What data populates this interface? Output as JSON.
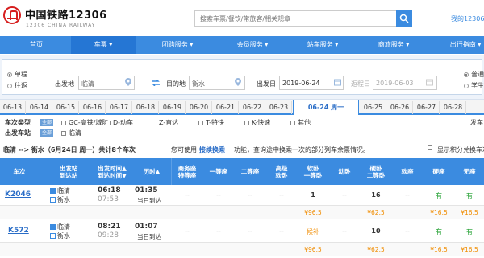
{
  "header": {
    "logo_title": "中国铁路12306",
    "logo_subtitle": "12306 CHINA RAILWAY",
    "search_placeholder": "搜索车票/餐饮/常旅客/相关规章",
    "my_account": "我的12306"
  },
  "nav": [
    {
      "label": "首页"
    },
    {
      "label": "车票 ▾"
    },
    {
      "label": "团购服务 ▾"
    },
    {
      "label": "会员服务 ▾"
    },
    {
      "label": "站车服务 ▾"
    },
    {
      "label": "商旅服务 ▾"
    },
    {
      "label": "出行指南 ▾"
    }
  ],
  "query": {
    "trip_single": "单程",
    "trip_round": "往返",
    "from_label": "出发地",
    "from_value": "临清",
    "to_label": "目的地",
    "to_value": "衡水",
    "depart_label": "出发日",
    "depart_value": "2019-06-24",
    "return_label": "返程日",
    "return_value": "2019-06-03",
    "type_normal": "普通",
    "type_student": "学生"
  },
  "dates": [
    "06-13",
    "06-14",
    "06-15",
    "06-16",
    "06-17",
    "06-18",
    "06-19",
    "06-20",
    "06-21",
    "06-22",
    "06-23",
    "06-24 周一",
    "06-25",
    "06-26",
    "06-27",
    "06-28"
  ],
  "filter": {
    "train_type_label": "车次类型",
    "depart_station_label": "出发车站",
    "all_btn": "全部",
    "types": [
      "GC-高铁/城际",
      "D-动车",
      "Z-直达",
      "T-特快",
      "K-快速",
      "其他"
    ],
    "station_linqing": "临清",
    "right_label": "发车"
  },
  "summary": {
    "route": "临清 --> 衡水（6月24日  周一）共计8个车次",
    "hint_prefix": "您可使用",
    "hint_link": "接续换乘",
    "hint_suffix": "功能，查询途中换乘一次的部分列车余票情况。",
    "points_label": "显示积分兑换车次"
  },
  "table": {
    "headers": [
      "车次",
      "出发站\n到达站",
      "出发时间▲\n到达时间▼",
      "历时▲",
      "商务座\n特等座",
      "一等座",
      "二等座",
      "高级\n软卧",
      "软卧\n一等卧",
      "动卧",
      "硬卧\n二等卧",
      "软座",
      "硬座",
      "无座"
    ],
    "rows": [
      {
        "train": "K2046",
        "from": "临清",
        "to": "衡水",
        "dep": "06:18",
        "arr": "07:53",
        "duration": "01:35",
        "duration_note": "当日到达",
        "cells": [
          "--",
          "--",
          "--",
          "--",
          "1",
          "--",
          "16",
          "--",
          "有",
          "有"
        ],
        "prices": [
          "",
          "",
          "",
          "",
          "¥96.5",
          "",
          "¥62.5",
          "",
          "¥16.5",
          "¥16.5"
        ]
      },
      {
        "train": "K572",
        "from": "临清",
        "to": "衡水",
        "dep": "08:21",
        "arr": "09:28",
        "duration": "01:07",
        "duration_note": "当日到达",
        "cells": [
          "--",
          "--",
          "--",
          "--",
          "候补",
          "--",
          "10",
          "--",
          "有",
          "有"
        ],
        "prices": [
          "",
          "",
          "",
          "",
          "¥96.5",
          "",
          "¥62.5",
          "",
          "¥16.5",
          "¥16.5"
        ]
      }
    ]
  }
}
